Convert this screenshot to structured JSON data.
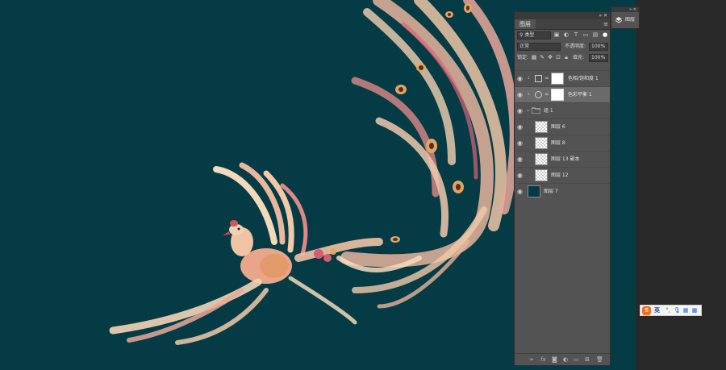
{
  "canvas": {
    "background": "#053b45",
    "artwork": "phoenix-illustration"
  },
  "layers_panel": {
    "tab_label": "图层",
    "filter": {
      "kind_label": "类型"
    },
    "blend_mode": "正常",
    "opacity_label": "不透明度:",
    "opacity_value": "100%",
    "lock_label": "锁定:",
    "fill_label": "填充:",
    "fill_value": "100%",
    "layers": [
      {
        "name": "色相/饱和度 1",
        "kind": "adjustment",
        "selected": false
      },
      {
        "name": "色彩平衡 1",
        "kind": "adjustment",
        "selected": true
      },
      {
        "name": "组 1",
        "kind": "group",
        "selected": false
      },
      {
        "name": "图层 6",
        "kind": "pixel",
        "selected": false
      },
      {
        "name": "图层 8",
        "kind": "pixel",
        "selected": false
      },
      {
        "name": "图层 13 副本",
        "kind": "pixel",
        "selected": false
      },
      {
        "name": "图层 12",
        "kind": "pixel",
        "selected": false
      },
      {
        "name": "图层 7",
        "kind": "fill",
        "selected": false
      }
    ]
  },
  "dock": {
    "label": "图层"
  },
  "ime": {
    "logo": "S",
    "language": "英"
  }
}
